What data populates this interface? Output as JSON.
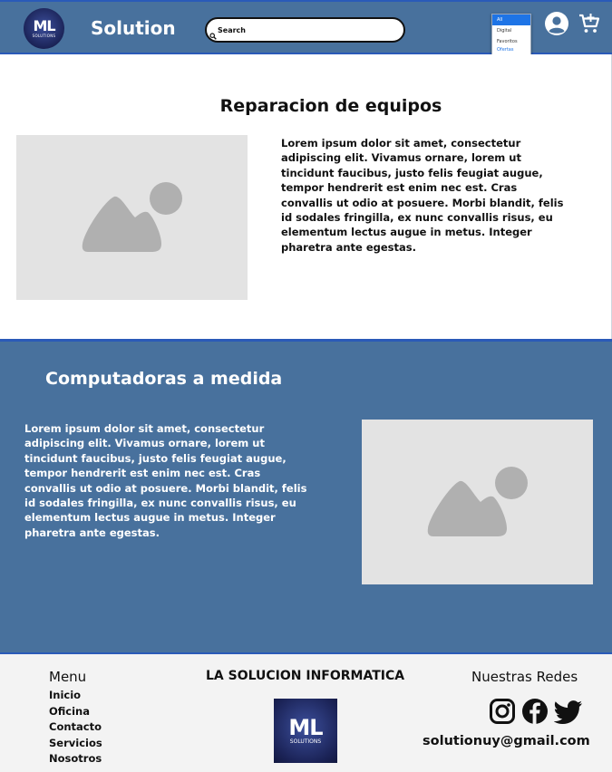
{
  "header": {
    "logo": {
      "mark": "ML",
      "sub": "SOLUTIONS"
    },
    "brand": "Solution",
    "search": {
      "placeholder": "Search",
      "icon": "search-icon"
    },
    "dropdown": {
      "options": [
        "All",
        "Digital",
        "Favoritos",
        "Ofertas"
      ],
      "selected": "All"
    },
    "icons": [
      "user-account-icon",
      "add-to-cart-icon"
    ]
  },
  "section1": {
    "title": "Reparacion de equipos",
    "text": "Lorem ipsum dolor sit amet, consectetur adipiscing elit. Vivamus ornare, lorem ut tincidunt faucibus, justo felis feugiat augue, tempor hendrerit est enim nec est. Cras convallis ut odio at posuere. Morbi blandit, felis id sodales fringilla, ex nunc convallis risus, eu elementum lectus augue in metus. Integer pharetra ante egestas."
  },
  "section2": {
    "title": "Computadoras a medida",
    "text": "Lorem ipsum dolor sit amet, consectetur adipiscing elit. Vivamus ornare, lorem ut tincidunt faucibus, justo felis feugiat augue, tempor hendrerit est enim nec est. Cras convallis ut odio at posuere. Morbi blandit, felis id sodales fringilla, ex nunc convallis risus, eu elementum lectus augue in metus. Integer pharetra ante egestas."
  },
  "footer": {
    "menu_title": "Menu",
    "menu_items": [
      "Inicio",
      "Oficina",
      "Contacto",
      "Servicios",
      "Nosotros"
    ],
    "company": "LA SOLUCION INFORMATICA",
    "logo": {
      "mark": "ML",
      "sub": "SOLUTIONS"
    },
    "redes_title": "Nuestras Redes",
    "social_icons": [
      "instagram-icon",
      "facebook-icon",
      "twitter-icon"
    ],
    "email": "solutionuy@gmail.com"
  },
  "colors": {
    "header_bg": "#48719d",
    "accent_border": "#2a5ab8",
    "placeholder_bg": "#e3e3e3",
    "footer_bg": "#f3f3f3"
  }
}
